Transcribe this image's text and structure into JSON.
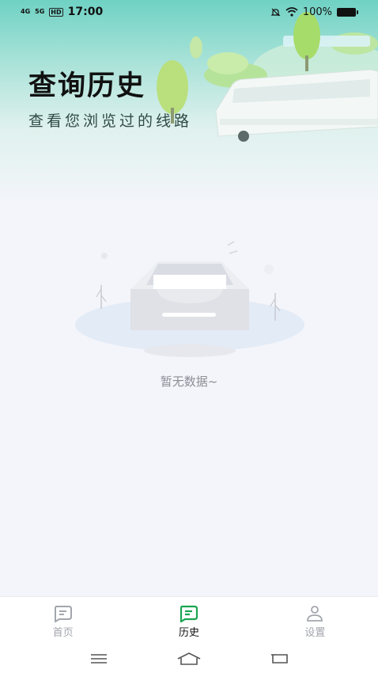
{
  "status_bar": {
    "signal_1": "4G",
    "signal_2": "5G",
    "hd": "HD",
    "time": "17:00",
    "battery": "100%"
  },
  "header": {
    "title": "查询历史",
    "subtitle": "查看您浏览过的线路"
  },
  "empty_state": {
    "message": "暂无数据~"
  },
  "tab_bar": {
    "tabs": [
      {
        "label": "首页",
        "icon": "home-icon",
        "active": false
      },
      {
        "label": "历史",
        "icon": "history-icon",
        "active": true
      },
      {
        "label": "设置",
        "icon": "user-icon",
        "active": false
      }
    ]
  },
  "colors": {
    "accent": "#1aa552",
    "inactive": "#a3a6ad"
  }
}
